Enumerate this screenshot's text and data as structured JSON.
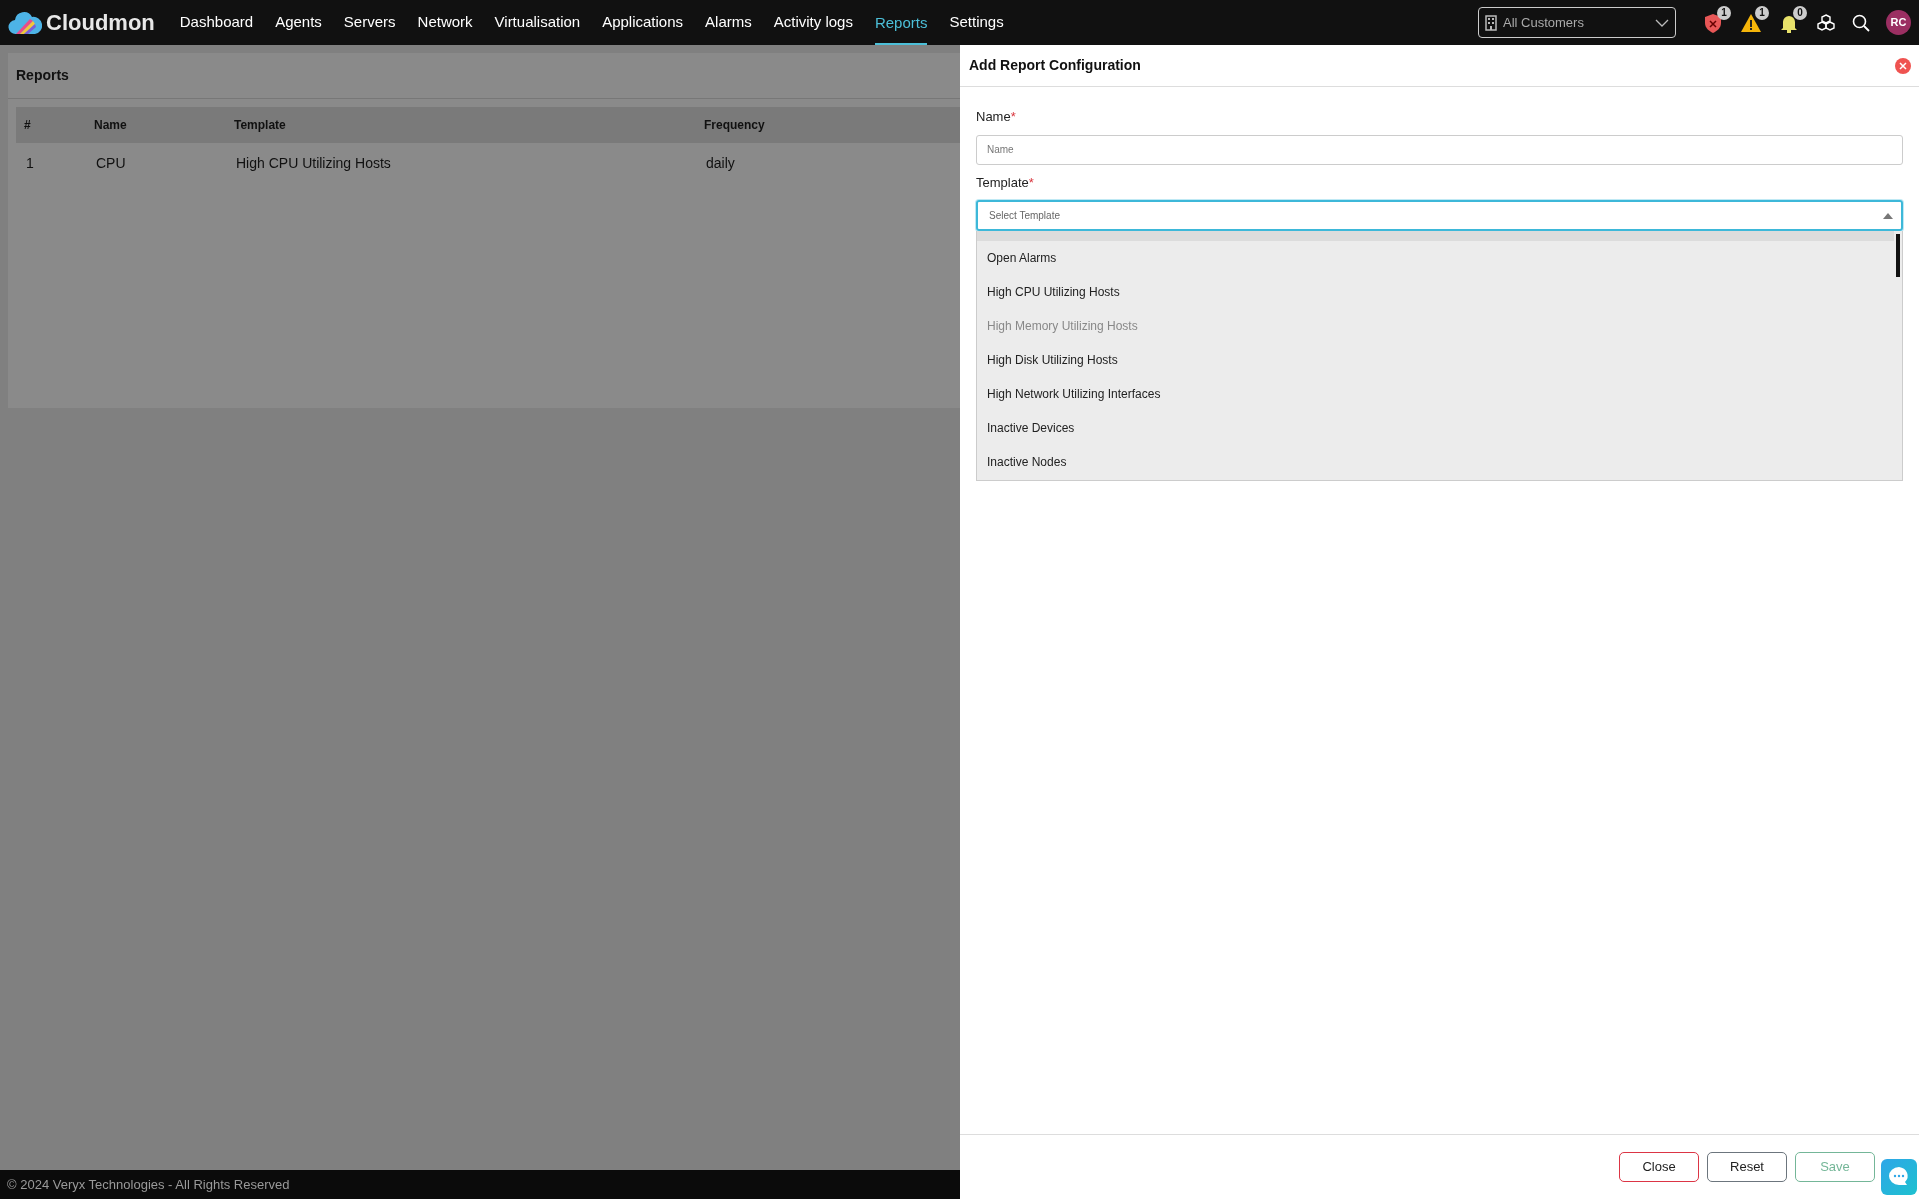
{
  "brand": "Cloudmon",
  "nav": [
    {
      "label": "Dashboard",
      "selected": false
    },
    {
      "label": "Agents",
      "selected": false
    },
    {
      "label": "Servers",
      "selected": false
    },
    {
      "label": "Network",
      "selected": false
    },
    {
      "label": "Virtualisation",
      "selected": false
    },
    {
      "label": "Applications",
      "selected": false
    },
    {
      "label": "Alarms",
      "selected": false
    },
    {
      "label": "Activity logs",
      "selected": false
    },
    {
      "label": "Reports",
      "selected": true
    },
    {
      "label": "Settings",
      "selected": false
    }
  ],
  "customer_select": {
    "value": "All Customers"
  },
  "indicators": [
    {
      "kind": "alarm",
      "count": "1"
    },
    {
      "kind": "warning",
      "count": "1"
    },
    {
      "kind": "notification",
      "count": "0"
    }
  ],
  "user": {
    "initials": "RC"
  },
  "reports": {
    "title": "Reports",
    "columns": [
      "#",
      "Name",
      "Template",
      "Frequency"
    ],
    "rows": [
      [
        "1",
        "CPU",
        "High CPU Utilizing Hosts",
        "daily"
      ]
    ]
  },
  "footer": "© 2024 Veryx Technologies - All Rights Reserved",
  "panel": {
    "title": "Add Report Configuration",
    "fields": [
      {
        "kind": "input",
        "label": "Name",
        "required_mark": "*",
        "placeholder": "Name",
        "focused": false
      },
      {
        "kind": "select",
        "label": "Template",
        "required_mark": "*",
        "placeholder": "Select Template",
        "focused": true,
        "expanded": true,
        "options": [
          {
            "label": "Open Alarms",
            "disabled": false
          },
          {
            "label": "High CPU Utilizing Hosts",
            "disabled": false
          },
          {
            "label": "High Memory Utilizing Hosts",
            "disabled": true
          },
          {
            "label": "High Disk Utilizing Hosts",
            "disabled": false
          },
          {
            "label": "High Network Utilizing Interfaces",
            "disabled": false
          },
          {
            "label": "Inactive Devices",
            "disabled": false
          },
          {
            "label": "Inactive Nodes",
            "disabled": false
          }
        ]
      }
    ],
    "buttons": [
      {
        "kind": "danger",
        "label": "Close",
        "disabled": false
      },
      {
        "kind": "secondary",
        "label": "Reset",
        "disabled": false
      },
      {
        "kind": "success",
        "label": "Save",
        "disabled": true
      }
    ]
  }
}
